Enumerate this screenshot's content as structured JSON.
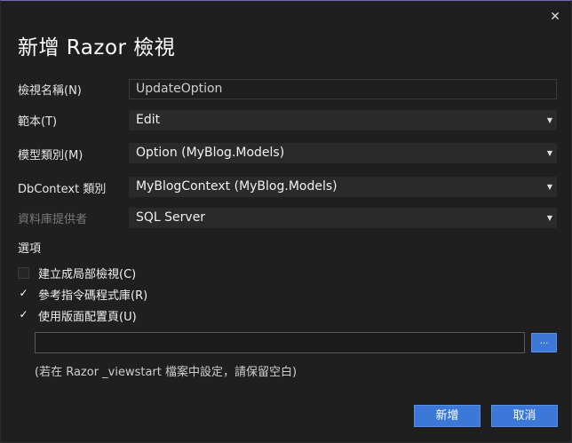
{
  "dialog": {
    "title": "新增 Razor 檢視",
    "close_glyph": "✕"
  },
  "form": {
    "view_name": {
      "label": "檢視名稱(N)",
      "value": "UpdateOption"
    },
    "template": {
      "label": "範本(T)",
      "value": "Edit"
    },
    "model_class": {
      "label": "模型類別(M)",
      "value": "Option (MyBlog.Models)"
    },
    "dbcontext_class": {
      "label": "DbContext 類別",
      "value": "MyBlogContext (MyBlog.Models)"
    },
    "database_provider": {
      "label": "資料庫提供者",
      "value": "SQL Server"
    }
  },
  "options": {
    "heading": "選項",
    "create_partial": {
      "label": "建立成局部檢視(C)",
      "checked": false
    },
    "reference_scripts": {
      "label": "參考指令碼程式庫(R)",
      "checked": true
    },
    "use_layout": {
      "label": "使用版面配置頁(U)",
      "checked": true
    },
    "layout_path": {
      "value": ""
    },
    "browse_label": "...",
    "hint": "(若在 Razor _viewstart 檔案中設定，請保留空白)"
  },
  "buttons": {
    "add": "新增",
    "cancel": "取消"
  },
  "icons": {
    "dropdown": "▼",
    "check": "✓"
  },
  "colors": {
    "background": "#1f1f1f",
    "accent": "#3c78d8",
    "field": "#2a2a2a"
  }
}
